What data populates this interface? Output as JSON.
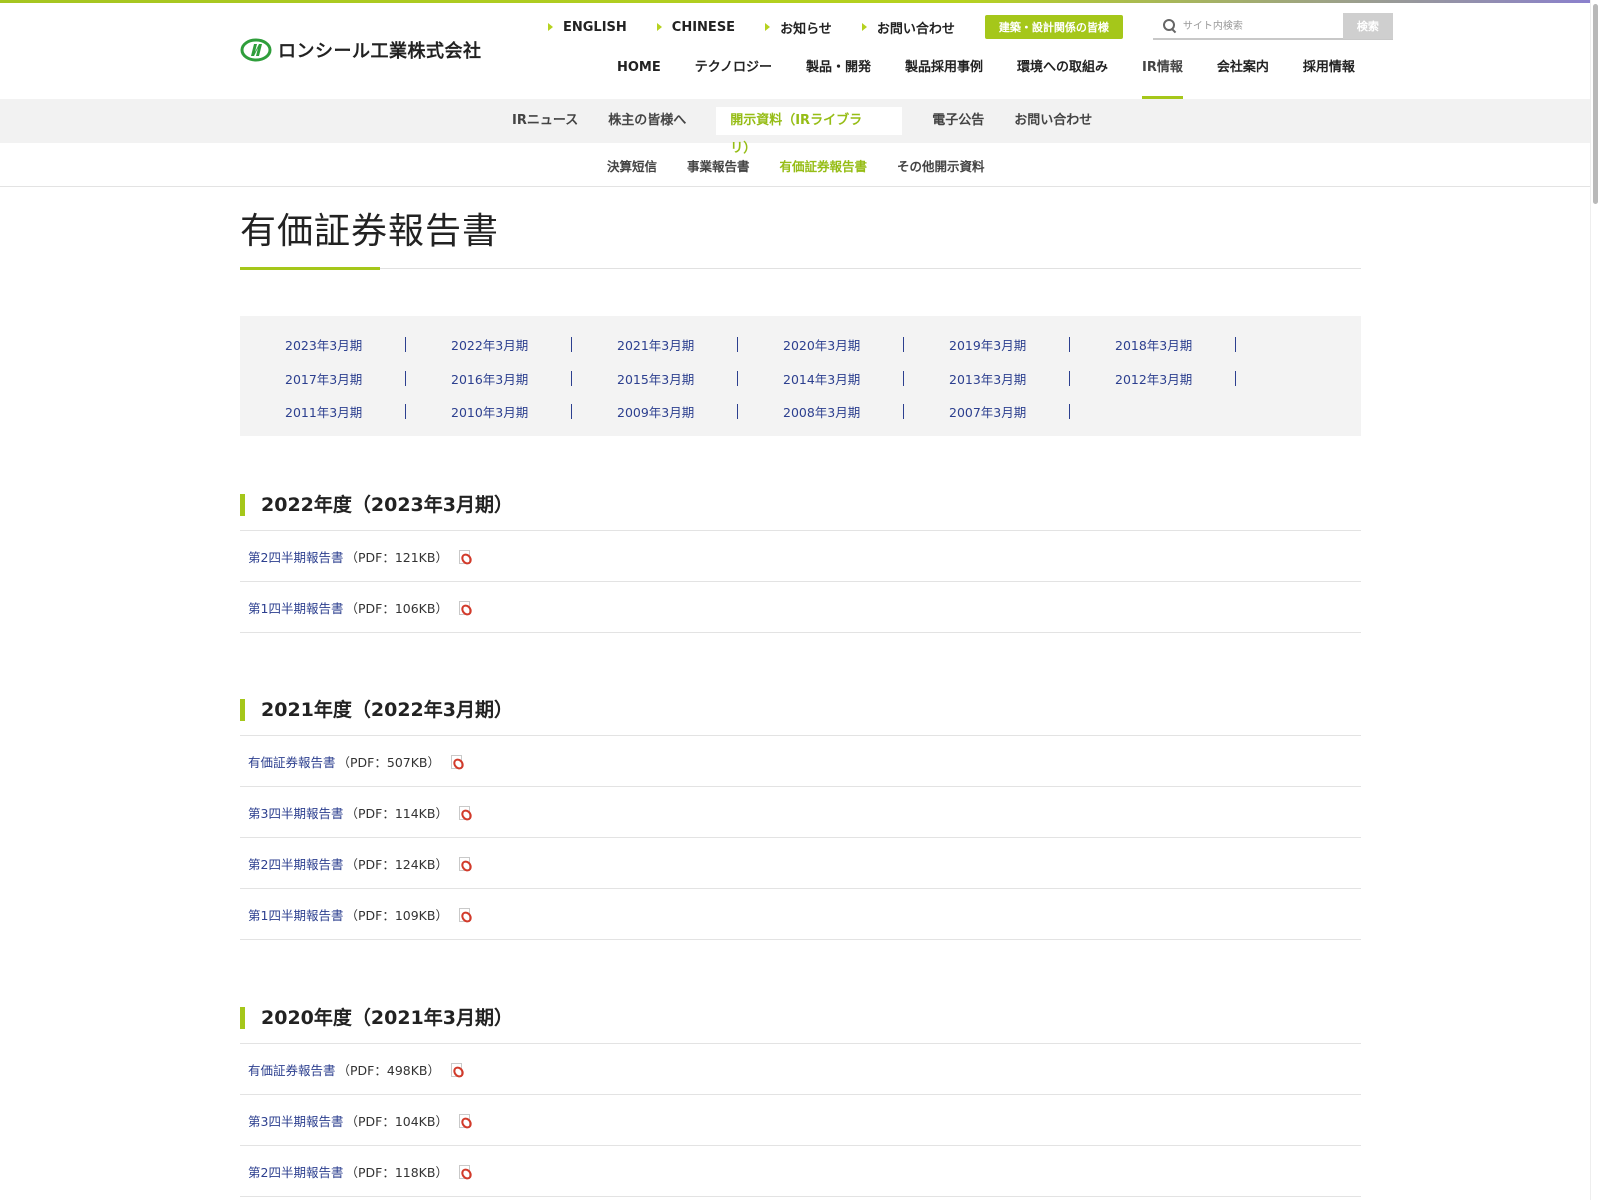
{
  "header": {
    "logo_text": "ロンシール工業株式会社",
    "utility_links": [
      "ENGLISH",
      "CHINESE",
      "お知らせ",
      "お問い合わせ"
    ],
    "green_button": "建築・設計関係の皆様",
    "search": {
      "placeholder": "サイト内検索",
      "button": "検索"
    },
    "main_nav": [
      "HOME",
      "テクノロジー",
      "製品・開発",
      "製品採用事例",
      "環境への取組み",
      "IR情報",
      "会社案内",
      "採用情報"
    ],
    "main_nav_active": "IR情報"
  },
  "subnav1": [
    "IRニュース",
    "株主の皆様へ",
    "開示資料（IRライブラリ）",
    "電子公告",
    "お問い合わせ"
  ],
  "subnav2": [
    "決算短信",
    "事業報告書",
    "有価証券報告書",
    "その他開示資料"
  ],
  "page_title": "有価証券報告書",
  "years": [
    [
      "2023年3月期",
      "2022年3月期",
      "2021年3月期",
      "2020年3月期",
      "2019年3月期",
      "2018年3月期"
    ],
    [
      "2017年3月期",
      "2016年3月期",
      "2015年3月期",
      "2014年3月期",
      "2013年3月期",
      "2012年3月期"
    ],
    [
      "2011年3月期",
      "2010年3月期",
      "2009年3月期",
      "2008年3月期",
      "2007年3月期"
    ]
  ],
  "sections": [
    {
      "heading": "2022年度（2023年3月期）",
      "docs": [
        {
          "label": "第2四半期報告書",
          "meta": "（PDF：121KB）"
        },
        {
          "label": "第1四半期報告書",
          "meta": "（PDF：106KB）"
        }
      ]
    },
    {
      "heading": "2021年度（2022年3月期）",
      "docs": [
        {
          "label": "有価証券報告書",
          "meta": "（PDF：507KB）"
        },
        {
          "label": "第3四半期報告書",
          "meta": "（PDF：114KB）"
        },
        {
          "label": "第2四半期報告書",
          "meta": "（PDF：124KB）"
        },
        {
          "label": "第1四半期報告書",
          "meta": "（PDF：109KB）"
        }
      ]
    },
    {
      "heading": "2020年度（2021年3月期）",
      "docs": [
        {
          "label": "有価証券報告書",
          "meta": "（PDF：498KB）"
        },
        {
          "label": "第3四半期報告書",
          "meta": "（PDF：104KB）"
        },
        {
          "label": "第2四半期報告書",
          "meta": "（PDF：118KB）"
        }
      ]
    }
  ],
  "colors": {
    "accent": "#a5c71a",
    "link": "#2c3f8f"
  }
}
